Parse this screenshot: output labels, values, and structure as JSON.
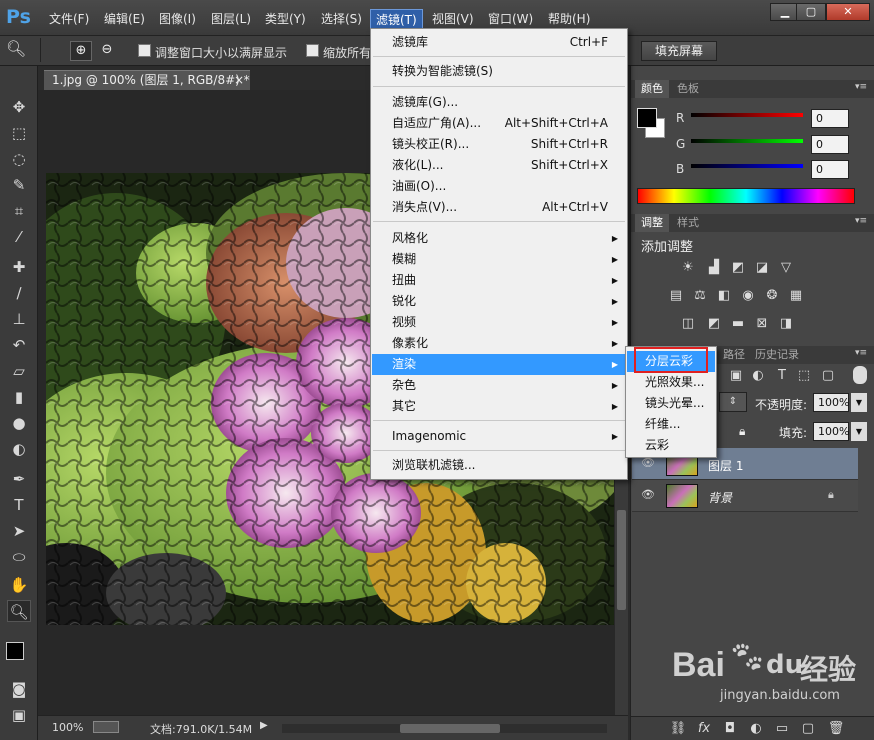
{
  "app": {
    "logo": "Ps"
  },
  "menubar": {
    "items": [
      "文件(F)",
      "编辑(E)",
      "图像(I)",
      "图层(L)",
      "类型(Y)",
      "选择(S)",
      "滤镜(T)",
      "视图(V)",
      "窗口(W)",
      "帮助(H)"
    ],
    "active_index": 6
  },
  "window_controls": {
    "minimize": "▁",
    "restore": "▢",
    "close": "✕"
  },
  "options_bar": {
    "resize_windows_label": "调整窗口大小以满屏显示",
    "zoom_all_label": "缩放所有",
    "fill_screen_button": "填充屏幕"
  },
  "document": {
    "tab_title": "1.jpg @ 100% (图层 1, RGB/8#) *",
    "tab_close": "×"
  },
  "status_bar": {
    "zoom": "100%",
    "doc_info": "文档:791.0K/1.54M"
  },
  "filter_menu": {
    "items": [
      {
        "label": "滤镜库",
        "shortcut": "Ctrl+F"
      },
      {
        "label": "转换为智能滤镜(S)",
        "shortcut": ""
      },
      {
        "label": "滤镜库(G)...",
        "shortcut": ""
      },
      {
        "label": "自适应广角(A)...",
        "shortcut": "Alt+Shift+Ctrl+A"
      },
      {
        "label": "镜头校正(R)...",
        "shortcut": "Shift+Ctrl+R"
      },
      {
        "label": "液化(L)...",
        "shortcut": "Shift+Ctrl+X"
      },
      {
        "label": "油画(O)...",
        "shortcut": ""
      },
      {
        "label": "消失点(V)...",
        "shortcut": "Alt+Ctrl+V"
      },
      {
        "label": "风格化",
        "shortcut": ""
      },
      {
        "label": "模糊",
        "shortcut": ""
      },
      {
        "label": "扭曲",
        "shortcut": ""
      },
      {
        "label": "锐化",
        "shortcut": ""
      },
      {
        "label": "视频",
        "shortcut": ""
      },
      {
        "label": "像素化",
        "shortcut": ""
      },
      {
        "label": "渲染",
        "shortcut": ""
      },
      {
        "label": "杂色",
        "shortcut": ""
      },
      {
        "label": "其它",
        "shortcut": ""
      },
      {
        "label": "Imagenomic",
        "shortcut": ""
      },
      {
        "label": "浏览联机滤镜...",
        "shortcut": ""
      }
    ],
    "highlighted": "渲染"
  },
  "render_submenu": {
    "items": [
      "分层云彩",
      "光照效果...",
      "镜头光晕...",
      "纤维...",
      "云彩"
    ],
    "highlighted_index": 0
  },
  "color_panel": {
    "tabs": [
      "颜色",
      "色板"
    ],
    "channels": [
      {
        "label": "R",
        "value": "0",
        "color": "#ff0000"
      },
      {
        "label": "G",
        "value": "0",
        "color": "#00ff00"
      },
      {
        "label": "B",
        "value": "0",
        "color": "#0000ff"
      }
    ]
  },
  "adjustments_panel": {
    "tabs": [
      "调整",
      "样式"
    ],
    "title": "添加调整"
  },
  "layers_panel": {
    "tabs": [
      "路径",
      "历史记录"
    ],
    "opacity_label": "不透明度:",
    "opacity_value": "100%",
    "fill_label": "填充:",
    "fill_value": "100%",
    "layers": [
      {
        "name": "图层 1",
        "selected": true,
        "locked": false
      },
      {
        "name": "背景",
        "selected": false,
        "locked": true
      }
    ]
  },
  "watermark": {
    "brand": "Bai",
    "mid": "du",
    "suffix": "经验",
    "url": "jingyan.baidu.com"
  }
}
